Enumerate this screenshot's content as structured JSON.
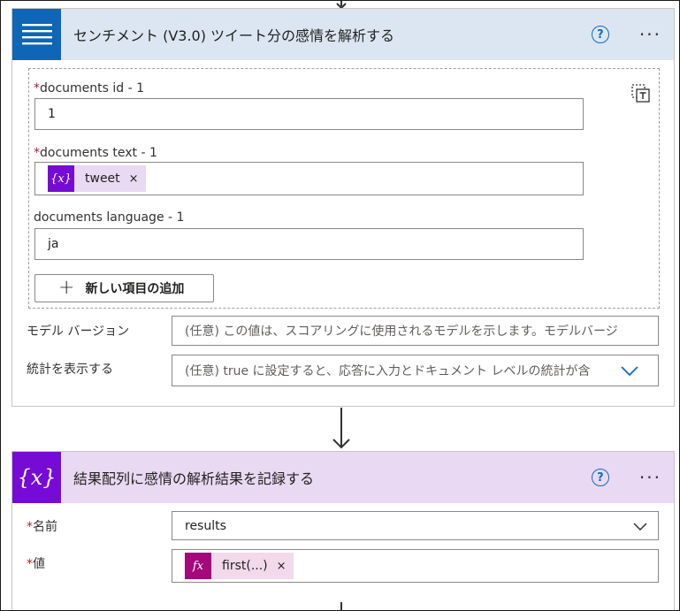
{
  "card1": {
    "title": "センチメント (V3.0) ツイート分の感情を解析する",
    "help": "?",
    "more": "···",
    "fields": {
      "documents_id": {
        "required": "*",
        "label": "documents id - 1",
        "value": "1"
      },
      "documents_text": {
        "required": "*",
        "label": "documents text - 1",
        "token_icon": "{x}",
        "token_label": "tweet",
        "token_remove": "×"
      },
      "documents_language": {
        "label": "documents language - 1",
        "value": "ja"
      }
    },
    "add_button": {
      "plus": "+",
      "label": "新しい項目の追加"
    },
    "model_version": {
      "label": "モデル バージョン",
      "placeholder": "(任意) この値は、スコアリングに使用されるモデルを示します。モデルバージ"
    },
    "show_stats": {
      "label": "統計を表示する",
      "placeholder": "(任意) true に設定すると、応答に入力とドキュメント レベルの統計が含"
    }
  },
  "card2": {
    "title": "結果配列に感情の解析結果を記録する",
    "help": "?",
    "more": "···",
    "name_field": {
      "required": "*",
      "label": "名前",
      "value": "results"
    },
    "value_field": {
      "required": "*",
      "label": "値",
      "token_icon": "fx",
      "token_label": "first(...)",
      "token_remove": "×"
    }
  },
  "colors": {
    "card1_header": "#dbe6f2",
    "card1_icon": "#0f65b6",
    "card2_header": "#ead9f2",
    "card2_icon": "#770bd6",
    "fx_token": "#a4087b",
    "var_token": "#770bd6",
    "accent": "#0f6cbd"
  },
  "icons": {
    "card1": "lines-icon",
    "card2": "variable-icon",
    "copy": "copy-paste-icon",
    "dropdown": "chevron-down-icon"
  }
}
